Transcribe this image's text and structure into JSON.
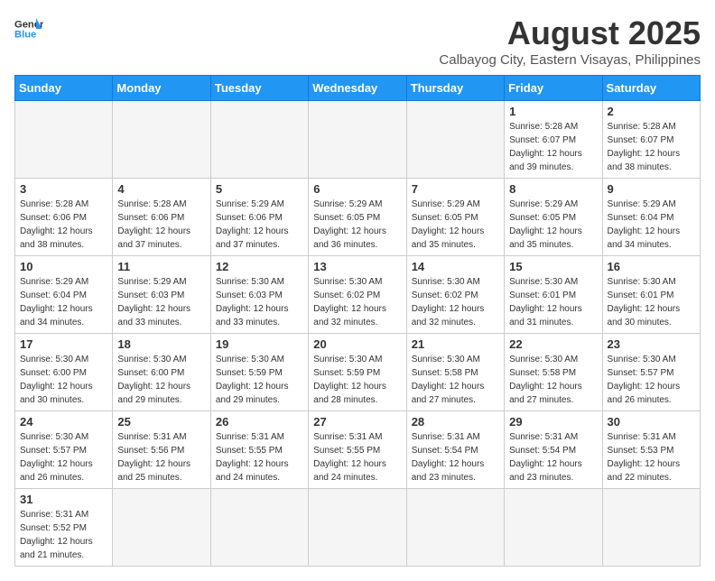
{
  "header": {
    "logo_line1": "General",
    "logo_line2": "Blue",
    "title": "August 2025",
    "subtitle": "Calbayog City, Eastern Visayas, Philippines"
  },
  "weekdays": [
    "Sunday",
    "Monday",
    "Tuesday",
    "Wednesday",
    "Thursday",
    "Friday",
    "Saturday"
  ],
  "weeks": [
    [
      {
        "day": "",
        "info": ""
      },
      {
        "day": "",
        "info": ""
      },
      {
        "day": "",
        "info": ""
      },
      {
        "day": "",
        "info": ""
      },
      {
        "day": "",
        "info": ""
      },
      {
        "day": "1",
        "info": "Sunrise: 5:28 AM\nSunset: 6:07 PM\nDaylight: 12 hours and 39 minutes."
      },
      {
        "day": "2",
        "info": "Sunrise: 5:28 AM\nSunset: 6:07 PM\nDaylight: 12 hours and 38 minutes."
      }
    ],
    [
      {
        "day": "3",
        "info": "Sunrise: 5:28 AM\nSunset: 6:06 PM\nDaylight: 12 hours and 38 minutes."
      },
      {
        "day": "4",
        "info": "Sunrise: 5:28 AM\nSunset: 6:06 PM\nDaylight: 12 hours and 37 minutes."
      },
      {
        "day": "5",
        "info": "Sunrise: 5:29 AM\nSunset: 6:06 PM\nDaylight: 12 hours and 37 minutes."
      },
      {
        "day": "6",
        "info": "Sunrise: 5:29 AM\nSunset: 6:05 PM\nDaylight: 12 hours and 36 minutes."
      },
      {
        "day": "7",
        "info": "Sunrise: 5:29 AM\nSunset: 6:05 PM\nDaylight: 12 hours and 35 minutes."
      },
      {
        "day": "8",
        "info": "Sunrise: 5:29 AM\nSunset: 6:05 PM\nDaylight: 12 hours and 35 minutes."
      },
      {
        "day": "9",
        "info": "Sunrise: 5:29 AM\nSunset: 6:04 PM\nDaylight: 12 hours and 34 minutes."
      }
    ],
    [
      {
        "day": "10",
        "info": "Sunrise: 5:29 AM\nSunset: 6:04 PM\nDaylight: 12 hours and 34 minutes."
      },
      {
        "day": "11",
        "info": "Sunrise: 5:29 AM\nSunset: 6:03 PM\nDaylight: 12 hours and 33 minutes."
      },
      {
        "day": "12",
        "info": "Sunrise: 5:30 AM\nSunset: 6:03 PM\nDaylight: 12 hours and 33 minutes."
      },
      {
        "day": "13",
        "info": "Sunrise: 5:30 AM\nSunset: 6:02 PM\nDaylight: 12 hours and 32 minutes."
      },
      {
        "day": "14",
        "info": "Sunrise: 5:30 AM\nSunset: 6:02 PM\nDaylight: 12 hours and 32 minutes."
      },
      {
        "day": "15",
        "info": "Sunrise: 5:30 AM\nSunset: 6:01 PM\nDaylight: 12 hours and 31 minutes."
      },
      {
        "day": "16",
        "info": "Sunrise: 5:30 AM\nSunset: 6:01 PM\nDaylight: 12 hours and 30 minutes."
      }
    ],
    [
      {
        "day": "17",
        "info": "Sunrise: 5:30 AM\nSunset: 6:00 PM\nDaylight: 12 hours and 30 minutes."
      },
      {
        "day": "18",
        "info": "Sunrise: 5:30 AM\nSunset: 6:00 PM\nDaylight: 12 hours and 29 minutes."
      },
      {
        "day": "19",
        "info": "Sunrise: 5:30 AM\nSunset: 5:59 PM\nDaylight: 12 hours and 29 minutes."
      },
      {
        "day": "20",
        "info": "Sunrise: 5:30 AM\nSunset: 5:59 PM\nDaylight: 12 hours and 28 minutes."
      },
      {
        "day": "21",
        "info": "Sunrise: 5:30 AM\nSunset: 5:58 PM\nDaylight: 12 hours and 27 minutes."
      },
      {
        "day": "22",
        "info": "Sunrise: 5:30 AM\nSunset: 5:58 PM\nDaylight: 12 hours and 27 minutes."
      },
      {
        "day": "23",
        "info": "Sunrise: 5:30 AM\nSunset: 5:57 PM\nDaylight: 12 hours and 26 minutes."
      }
    ],
    [
      {
        "day": "24",
        "info": "Sunrise: 5:30 AM\nSunset: 5:57 PM\nDaylight: 12 hours and 26 minutes."
      },
      {
        "day": "25",
        "info": "Sunrise: 5:31 AM\nSunset: 5:56 PM\nDaylight: 12 hours and 25 minutes."
      },
      {
        "day": "26",
        "info": "Sunrise: 5:31 AM\nSunset: 5:55 PM\nDaylight: 12 hours and 24 minutes."
      },
      {
        "day": "27",
        "info": "Sunrise: 5:31 AM\nSunset: 5:55 PM\nDaylight: 12 hours and 24 minutes."
      },
      {
        "day": "28",
        "info": "Sunrise: 5:31 AM\nSunset: 5:54 PM\nDaylight: 12 hours and 23 minutes."
      },
      {
        "day": "29",
        "info": "Sunrise: 5:31 AM\nSunset: 5:54 PM\nDaylight: 12 hours and 23 minutes."
      },
      {
        "day": "30",
        "info": "Sunrise: 5:31 AM\nSunset: 5:53 PM\nDaylight: 12 hours and 22 minutes."
      }
    ],
    [
      {
        "day": "31",
        "info": "Sunrise: 5:31 AM\nSunset: 5:52 PM\nDaylight: 12 hours and 21 minutes."
      },
      {
        "day": "",
        "info": ""
      },
      {
        "day": "",
        "info": ""
      },
      {
        "day": "",
        "info": ""
      },
      {
        "day": "",
        "info": ""
      },
      {
        "day": "",
        "info": ""
      },
      {
        "day": "",
        "info": ""
      }
    ]
  ]
}
